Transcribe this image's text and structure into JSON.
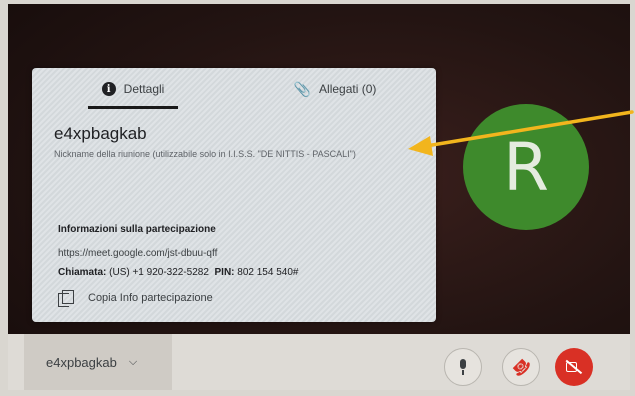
{
  "panel": {
    "tabs": [
      {
        "label": "Dettagli",
        "icon": "info-icon"
      },
      {
        "label": "Allegati (0)",
        "icon": "paperclip-icon"
      }
    ],
    "meeting_name": "e4xpbagkab",
    "nickname_note": "Nickname della riunione (utilizzabile solo in I.I.S.S. \"DE NITTIS - PASCALI\")",
    "join_section_title": "Informazioni sulla partecipazione",
    "meet_link": "https://meet.google.com/jst-dbuu-qff",
    "dial_label": "Chiamata:",
    "dial_number": "(US) +1 920-322-5282",
    "pin_label": "PIN:",
    "pin_value": "802 154 540#",
    "copy_label": "Copia Info partecipazione"
  },
  "participant": {
    "initial": "R",
    "color": "#3e8a2c"
  },
  "bottom_bar": {
    "meeting_chip": "e4xpbagkab"
  },
  "colors": {
    "arrow": "#f2b51d",
    "hangup": "#d93025",
    "camera_off": "#d93025"
  }
}
